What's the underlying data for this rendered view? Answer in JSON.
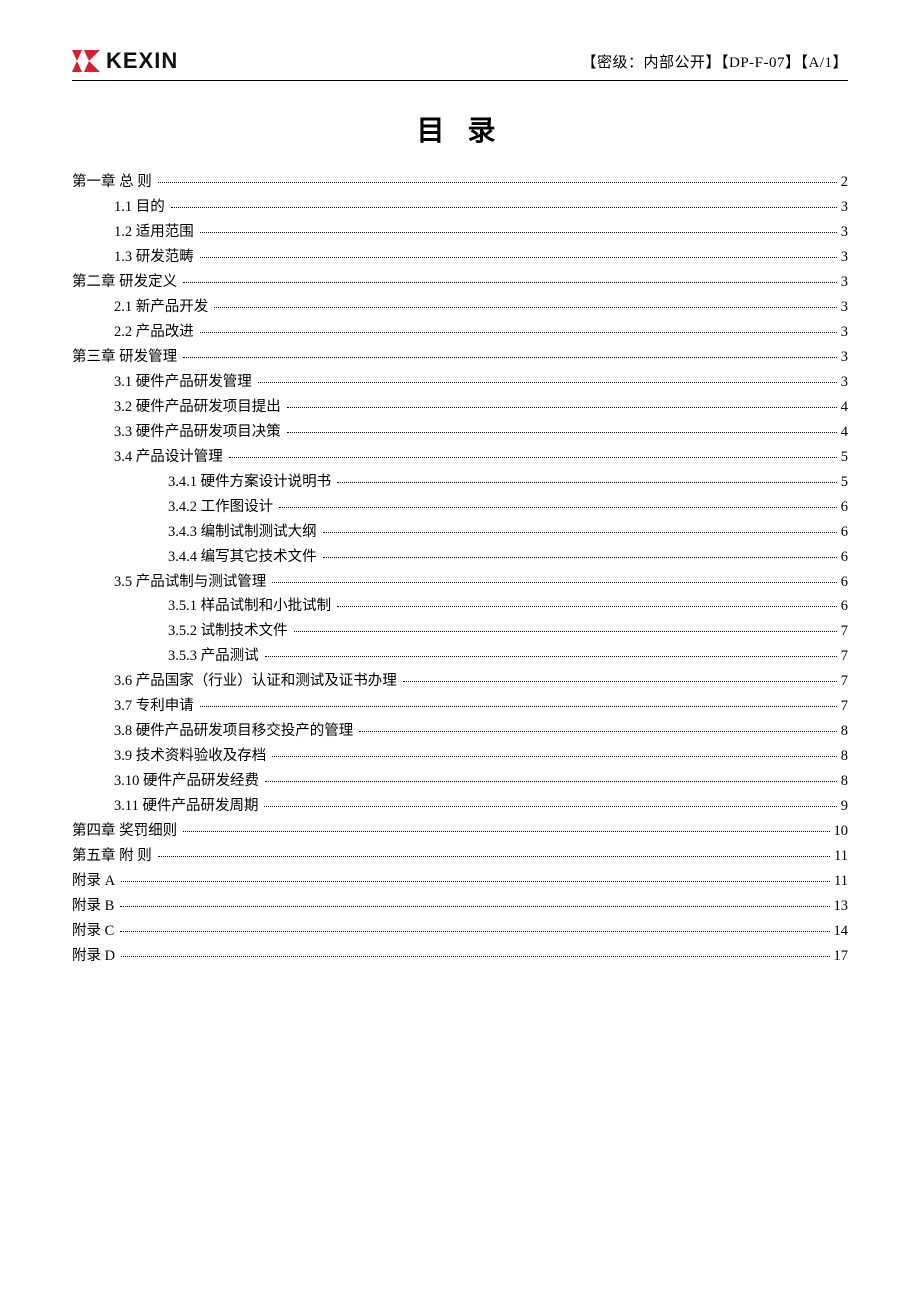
{
  "header": {
    "logo_text": "KEXIN",
    "right_text": "【密级：内部公开】【DP-F-07】【A/1】"
  },
  "title": "目 录",
  "toc": [
    {
      "level": 0,
      "label": "第一章  总  则",
      "page": "2"
    },
    {
      "level": 1,
      "label": "1.1  目的",
      "page": "3"
    },
    {
      "level": 1,
      "label": "1.2  适用范围",
      "page": "3"
    },
    {
      "level": 1,
      "label": "1.3  研发范畴",
      "page": "3"
    },
    {
      "level": 0,
      "label": "第二章  研发定义",
      "page": "3"
    },
    {
      "level": 1,
      "label": "2.1 新产品开发",
      "page": "3"
    },
    {
      "level": 1,
      "label": "2.2 产品改进",
      "page": "3"
    },
    {
      "level": 0,
      "label": "第三章  研发管理",
      "page": "3"
    },
    {
      "level": 1,
      "label": "3.1 硬件产品研发管理",
      "page": "3"
    },
    {
      "level": 1,
      "label": "3.2 硬件产品研发项目提出",
      "page": "4"
    },
    {
      "level": 1,
      "label": "3.3 硬件产品研发项目决策",
      "page": "4"
    },
    {
      "level": 1,
      "label": "3.4 产品设计管理",
      "page": "5"
    },
    {
      "level": 2,
      "label": "3.4.1  硬件方案设计说明书",
      "page": "5"
    },
    {
      "level": 2,
      "label": "3.4.2  工作图设计",
      "page": "6"
    },
    {
      "level": 2,
      "label": "3.4.3  编制试制测试大纲",
      "page": "6"
    },
    {
      "level": 2,
      "label": "3.4.4  编写其它技术文件",
      "page": "6"
    },
    {
      "level": 1,
      "label": "3.5 产品试制与测试管理",
      "page": "6"
    },
    {
      "level": 2,
      "label": "3.5.1  样品试制和小批试制",
      "page": "6"
    },
    {
      "level": 2,
      "label": "3.5.2  试制技术文件",
      "page": "7"
    },
    {
      "level": 2,
      "label": "3.5.3  产品测试",
      "page": "7"
    },
    {
      "level": 1,
      "label": "3.6  产品国家（行业）认证和测试及证书办理",
      "page": "7"
    },
    {
      "level": 1,
      "label": "3.7 专利申请",
      "page": "7"
    },
    {
      "level": 1,
      "label": "3.8 硬件产品研发项目移交投产的管理",
      "page": "8"
    },
    {
      "level": 1,
      "label": "3.9 技术资料验收及存档",
      "page": "8"
    },
    {
      "level": 1,
      "label": "3.10  硬件产品研发经费",
      "page": "8"
    },
    {
      "level": 1,
      "label": "3.11  硬件产品研发周期",
      "page": "9"
    },
    {
      "level": 0,
      "label": "第四章  奖罚细则",
      "page": "10"
    },
    {
      "level": 0,
      "label": "第五章  附    则",
      "page": "11"
    },
    {
      "level": 0,
      "label": "附录 A",
      "page": "11"
    },
    {
      "level": 0,
      "label": "附录 B",
      "page": "13"
    },
    {
      "level": 0,
      "label": "附录 C",
      "page": "14"
    },
    {
      "level": 0,
      "label": "附录 D",
      "page": "17"
    }
  ]
}
